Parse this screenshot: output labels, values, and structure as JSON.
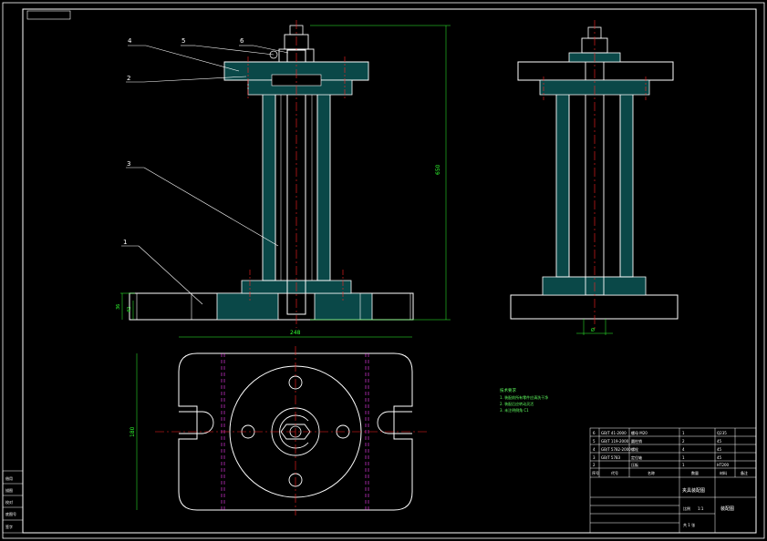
{
  "drawing": {
    "colors": {
      "background": "#000000",
      "outline": "#ffffff",
      "hatch": "#00a0a0",
      "center_line": "#ff2020",
      "hidden_line": "#ff40ff",
      "dimension": "#30ff30",
      "notes": "#60ff60"
    },
    "balloons": [
      "4",
      "5",
      "6",
      "2",
      "3",
      "1"
    ],
    "dimensions": {
      "total_height": "650",
      "base_height_a": "36",
      "base_height_b": "42",
      "shaft_dia": "Ø",
      "base_length": "248",
      "base_width": "180"
    },
    "notes": {
      "heading": "技术要求",
      "lines": [
        "1. 装配前所有零件应清洗干净",
        "2. 装配后应转动灵活",
        "3. 未注明倒角 C1"
      ]
    },
    "title_block": {
      "name": "夹具装配图",
      "drawing_no": "装配图",
      "parts": [
        {
          "no": "6",
          "std": "GB/T 41-2000",
          "name": "螺母 M20",
          "qty": "1",
          "mat": "Q235"
        },
        {
          "no": "5",
          "std": "GB/T 119-2000",
          "name": "圆柱销",
          "qty": "2",
          "mat": "45"
        },
        {
          "no": "4",
          "std": "GB/T 5782-2000",
          "name": "螺栓",
          "qty": "4",
          "mat": "45"
        },
        {
          "no": "3",
          "std": "GB/T 5783",
          "name": "定位轴",
          "qty": "1",
          "mat": "45"
        },
        {
          "no": "2",
          "std": "",
          "name": "压板",
          "qty": "1",
          "mat": "HT200"
        }
      ],
      "header": [
        "序号",
        "代号",
        "名称",
        "数量",
        "材料",
        "备注"
      ],
      "scale_label": "比例",
      "scale": "1:1",
      "sheet": "共 1 张"
    },
    "side_stamp": [
      "借用",
      "描图",
      "校对",
      "底图号",
      "签字"
    ]
  }
}
